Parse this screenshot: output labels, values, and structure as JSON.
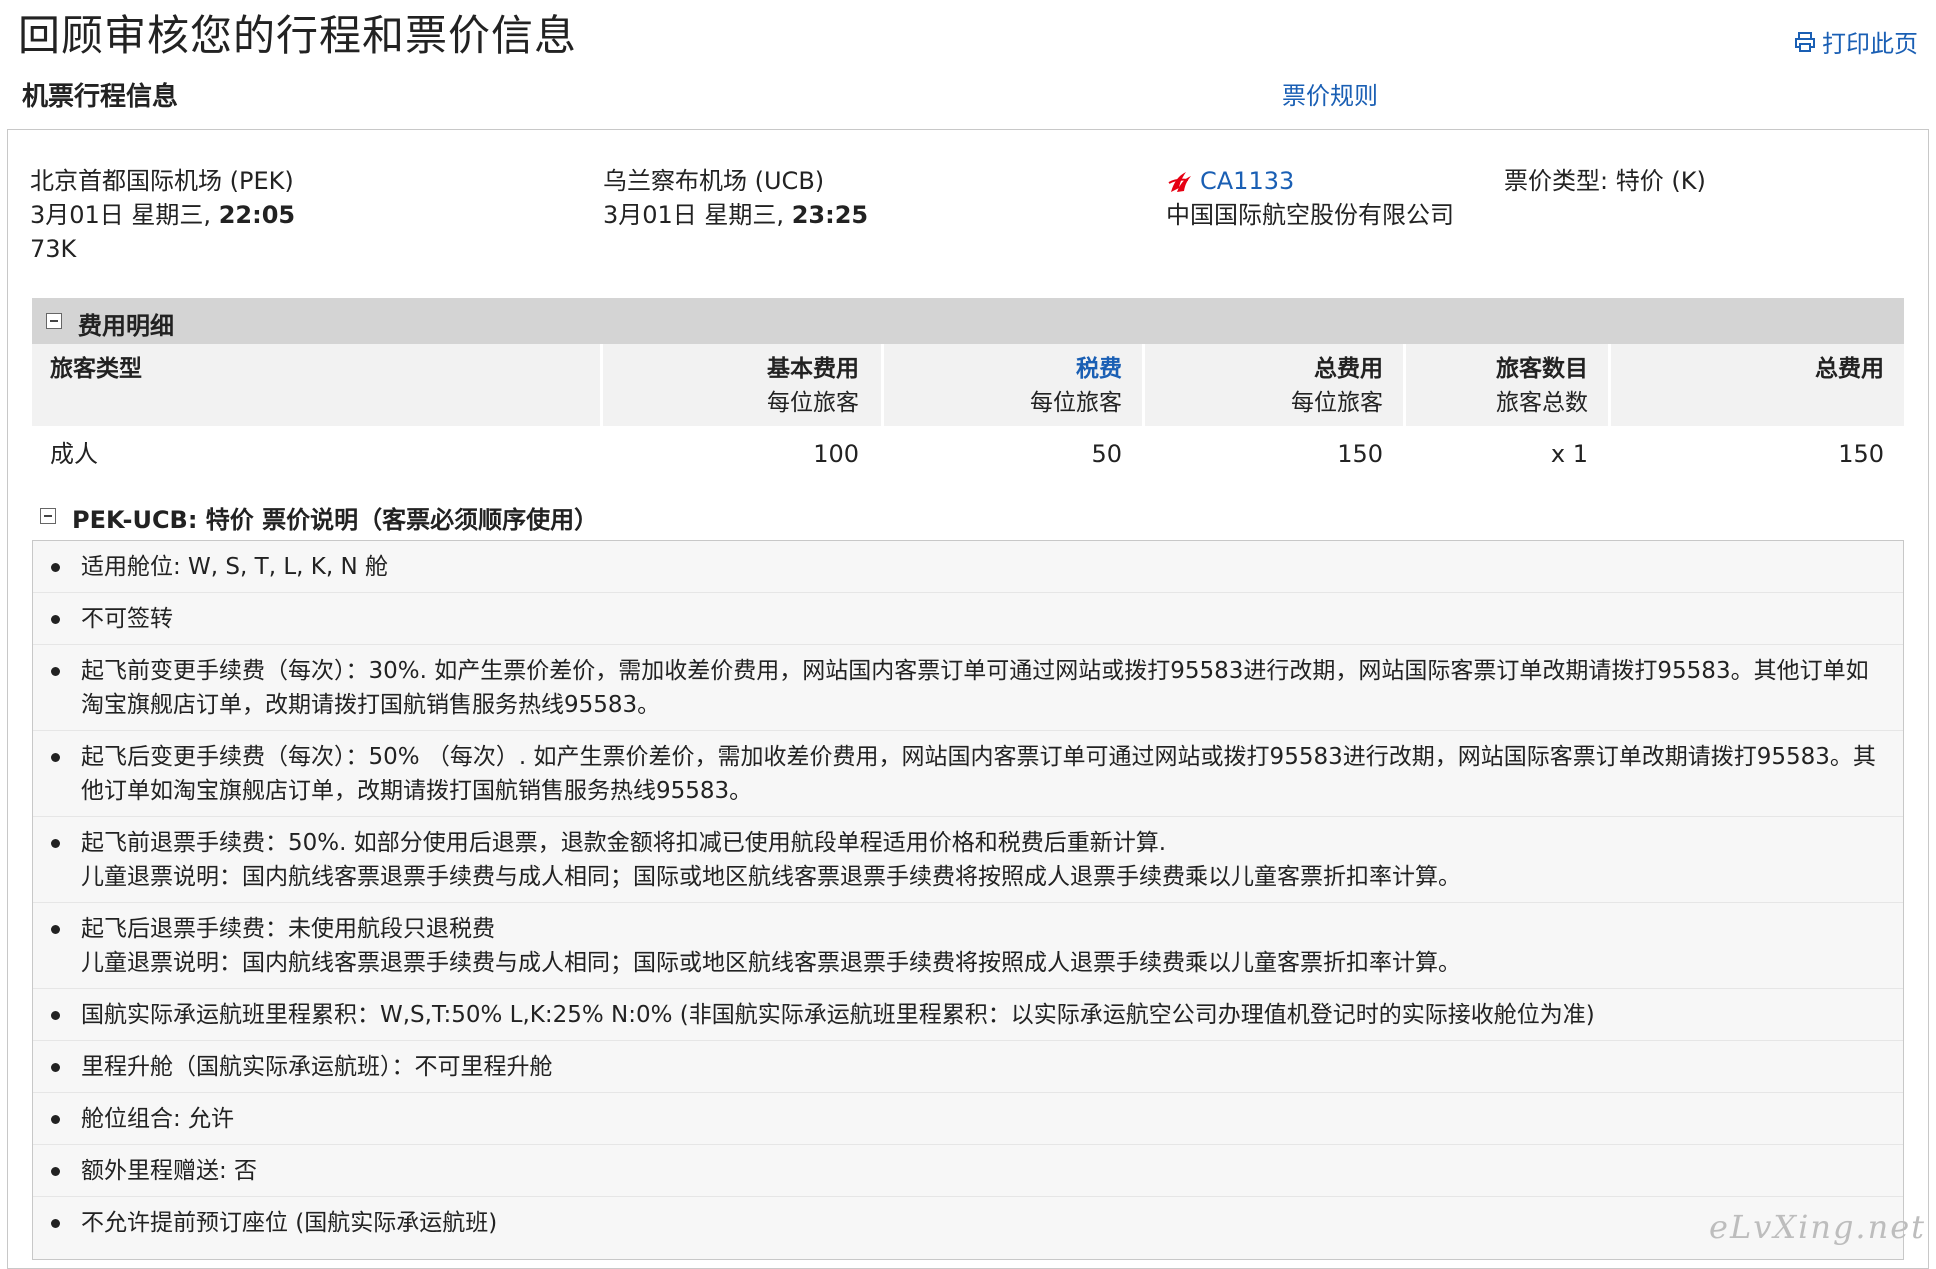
{
  "header": {
    "title": "回顾审核您的行程和票价信息",
    "print_label": "打印此页",
    "section_title": "机票行程信息",
    "fare_rules_link": "票价规则"
  },
  "flight": {
    "origin_airport": "北京首都国际机场 (PEK)",
    "origin_date": "3月01日 星期三, ",
    "origin_time": "22:05",
    "aircraft": "73K",
    "dest_airport": "乌兰察布机场 (UCB)",
    "dest_date": "3月01日 星期三, ",
    "dest_time": "23:25",
    "flight_number": "CA1133",
    "airline_name": "中国国际航空股份有限公司",
    "fare_type_label": "票价类型: ",
    "fare_type_value": "特价 (K)",
    "airline_logo_color": "#e60012"
  },
  "fees": {
    "title": "费用明细",
    "columns": {
      "passenger_type": "旅客类型",
      "base_fee": "基本费用",
      "base_fee_sub": "每位旅客",
      "tax": "税费",
      "tax_sub": "每位旅客",
      "total_per": "总费用",
      "total_per_sub": "每位旅客",
      "count": "旅客数目",
      "count_sub": "旅客总数",
      "grand_total": "总费用"
    },
    "row": {
      "type": "成人",
      "base": "100",
      "tax": "50",
      "total_per": "150",
      "count": "x 1",
      "grand_total": "150"
    }
  },
  "rules": {
    "heading": "PEK-UCB: 特价 票价说明（客票必须顺序使用）",
    "items": [
      "适用舱位: W, S, T, L, K, N 舱",
      "不可签转",
      "起飞前变更手续费（每次）：30%. 如产生票价差价，需加收差价费用，网站国内客票订单可通过网站或拨打95583进行改期，网站国际客票订单改期请拨打95583。其他订单如淘宝旗舰店订单，改期请拨打国航销售服务热线95583。",
      "起飞后变更手续费（每次）：50% （每次）. 如产生票价差价，需加收差价费用，网站国内客票订单可通过网站或拨打95583进行改期，网站国际客票订单改期请拨打95583。其他订单如淘宝旗舰店订单，改期请拨打国航销售服务热线95583。",
      "起飞前退票手续费：50%. 如部分使用后退票，退款金额将扣减已使用航段单程适用价格和税费后重新计算.",
      "儿童退票说明：国内航线客票退票手续费与成人相同；国际或地区航线客票退票手续费将按照成人退票手续费乘以儿童客票折扣率计算。",
      "起飞后退票手续费：未使用航段只退税费",
      "儿童退票说明：国内航线客票退票手续费与成人相同；国际或地区航线客票退票手续费将按照成人退票手续费乘以儿童客票折扣率计算。",
      "国航实际承运航班里程累积：W,S,T:50% L,K:25% N:0% (非国航实际承运航班里程累积：以实际承运航空公司办理值机登记时的实际接收舱位为准)",
      "里程升舱（国航实际承运航班）：不可里程升舱",
      "舱位组合: 允许",
      "额外里程赠送: 否",
      "不允许提前预订座位 (国航实际承运航班)"
    ]
  },
  "watermark": "eLvXing.net",
  "colors": {
    "link": "#1a5fb4",
    "header_bg": "#d4d4d4",
    "rules_bg": "#f7f7f7"
  }
}
